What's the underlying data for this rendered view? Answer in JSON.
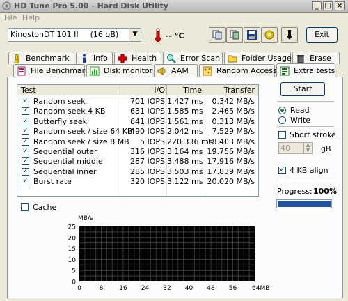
{
  "window": {
    "title": "HD Tune Pro 5.00 - Hard Disk Utility"
  },
  "menu": {
    "file": "File",
    "help": "Help"
  },
  "toolbar": {
    "drive": "KingstonDT 101 II",
    "drive_size": "(16 gB)",
    "temperature": "-- °C",
    "exit_label": "Exit"
  },
  "tabs_top": [
    {
      "label": "Benchmark",
      "icon": "thermometer-icon",
      "color": "#d4a800"
    },
    {
      "label": "Info",
      "icon": "info-icon",
      "color": "#1a3e8c"
    },
    {
      "label": "Health",
      "icon": "health-cross-icon",
      "color": "#cc0000"
    },
    {
      "label": "Error Scan",
      "icon": "magnifier-icon",
      "color": "#2a7a2a"
    },
    {
      "label": "Folder Usage",
      "icon": "folder-icon",
      "color": "#e0b000"
    },
    {
      "label": "Erase",
      "icon": "trash-icon",
      "color": "#444444"
    }
  ],
  "tabs_bottom": [
    {
      "label": "File Benchmark",
      "icon": "file-benchmark-icon",
      "color": "#aa2266"
    },
    {
      "label": "Disk monitor",
      "icon": "disk-monitor-icon",
      "color": "#2a8a2a"
    },
    {
      "label": "AAM",
      "icon": "speaker-icon",
      "color": "#d4a800"
    },
    {
      "label": "Random Access",
      "icon": "random-access-icon",
      "color": "#c08000"
    },
    {
      "label": "Extra tests",
      "icon": "extra-tests-icon",
      "color": "#1a6a1a"
    }
  ],
  "table": {
    "headers": {
      "test": "Test",
      "io": "I/O",
      "time": "Time",
      "transfer": "Transfer"
    },
    "rows": [
      {
        "test": "Random seek",
        "io": "701 IOPS",
        "time": "1.427 ms",
        "transfer": "0.342 MB/s"
      },
      {
        "test": "Random seek 4 KB",
        "io": "631 IOPS",
        "time": "1.585 ms",
        "transfer": "2.465 MB/s"
      },
      {
        "test": "Butterfly seek",
        "io": "641 IOPS",
        "time": "1.561 ms",
        "transfer": "0.313 MB/s"
      },
      {
        "test": "Random seek / size 64 KB",
        "io": "490 IOPS",
        "time": "2.042 ms",
        "transfer": "7.529 MB/s"
      },
      {
        "test": "Random seek / size 8 MB",
        "io": "5 IOPS",
        "time": "220.336 ms",
        "transfer": "18.403 MB/s"
      },
      {
        "test": "Sequential outer",
        "io": "316 IOPS",
        "time": "3.164 ms",
        "transfer": "19.756 MB/s"
      },
      {
        "test": "Sequential middle",
        "io": "287 IOPS",
        "time": "3.488 ms",
        "transfer": "17.916 MB/s"
      },
      {
        "test": "Sequential inner",
        "io": "285 IOPS",
        "time": "3.503 ms",
        "transfer": "17.839 MB/s"
      },
      {
        "test": "Burst rate",
        "io": "320 IOPS",
        "time": "3.122 ms",
        "transfer": "20.020 MB/s"
      }
    ]
  },
  "controls": {
    "start_label": "Start",
    "read_label": "Read",
    "write_label": "Write",
    "mode_selected": "Read",
    "short_stroke_label": "Short stroke",
    "short_stroke_value": "40",
    "short_stroke_unit": "gB",
    "short_stroke_checked": false,
    "align_label": "4 KB align",
    "align_checked": true,
    "progress_label": "Progress:",
    "progress_text": "100%",
    "progress_value": 1.0,
    "cache_label": "Cache",
    "cache_checked": false
  },
  "graph": {
    "y_unit": "MB/s",
    "y_ticks": [
      "25",
      "20",
      "15",
      "10",
      "5",
      "0"
    ],
    "x_ticks": [
      "0",
      "8",
      "16",
      "24",
      "32",
      "40",
      "48",
      "56",
      "64MB"
    ],
    "background": "#000000",
    "grid_color": "#3a3a3a"
  }
}
